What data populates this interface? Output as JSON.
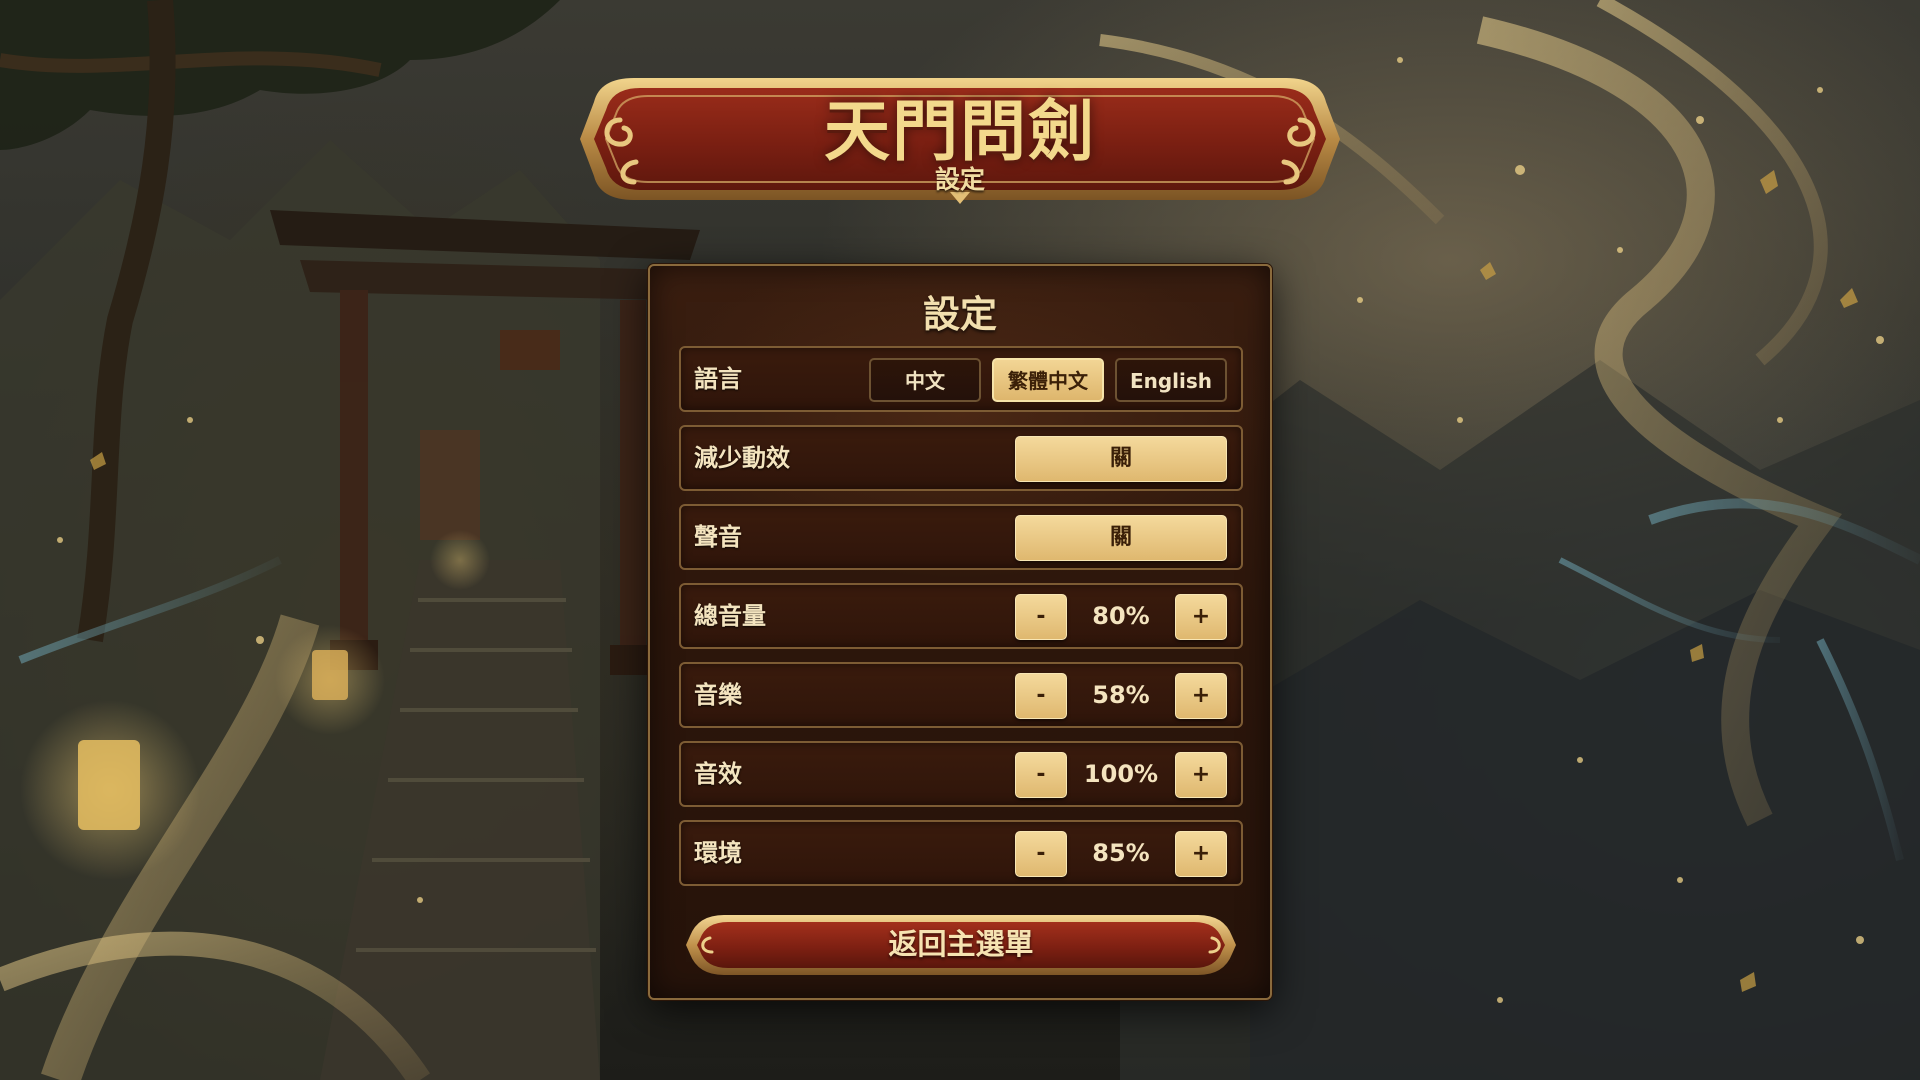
{
  "game": {
    "title": "天門問劍",
    "subtitle": "設定"
  },
  "panel": {
    "title": "設定"
  },
  "language": {
    "label": "語言",
    "options": [
      "中文",
      "繁體中文",
      "English"
    ],
    "selected": "繁體中文"
  },
  "reduce_motion": {
    "label": "減少動效",
    "value": "關"
  },
  "sound": {
    "label": "聲音",
    "value": "關"
  },
  "master_volume": {
    "label": "總音量",
    "value": "80%",
    "minus": "-",
    "plus": "+"
  },
  "music": {
    "label": "音樂",
    "value": "58%",
    "minus": "-",
    "plus": "+"
  },
  "sfx": {
    "label": "音效",
    "value": "100%",
    "minus": "-",
    "plus": "+"
  },
  "ambient": {
    "label": "環境",
    "value": "85%",
    "minus": "-",
    "plus": "+"
  },
  "return_button": {
    "label": "返回主選單"
  },
  "colors": {
    "gold": "#f3d98c",
    "button_gold": "#e9c983",
    "panel_bg": "#2c160b",
    "plaque_red": "#8a2516",
    "border_bronze": "#8a6a3c"
  }
}
